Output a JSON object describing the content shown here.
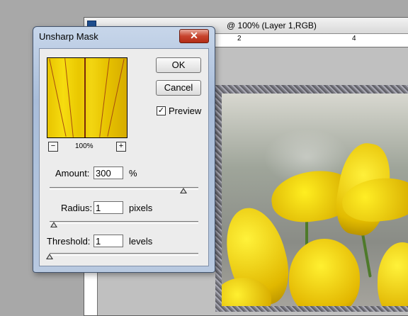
{
  "document": {
    "title": "@ 100% (Layer 1,RGB)",
    "ruler_labels": [
      "2",
      "4"
    ]
  },
  "dialog": {
    "title": "Unsharp Mask",
    "close_label": "✕",
    "ok_label": "OK",
    "cancel_label": "Cancel",
    "preview_label": "Preview",
    "preview_checked": true,
    "check_mark": "✓",
    "zoom_level": "100%",
    "zoom_out_label": "−",
    "zoom_in_label": "+",
    "amount": {
      "label": "Amount:",
      "value": "300",
      "unit": "%",
      "slider_fraction": 0.9
    },
    "radius": {
      "label": "Radius:",
      "value": "1",
      "unit": "pixels",
      "slider_fraction": 0.03
    },
    "threshold": {
      "label": "Threshold:",
      "value": "1",
      "unit": "levels",
      "slider_fraction": 0.0
    }
  },
  "colors": {
    "close_button": "#c7432d",
    "dialog_frame": "#a9bdd9",
    "flower": "#f2d612"
  }
}
